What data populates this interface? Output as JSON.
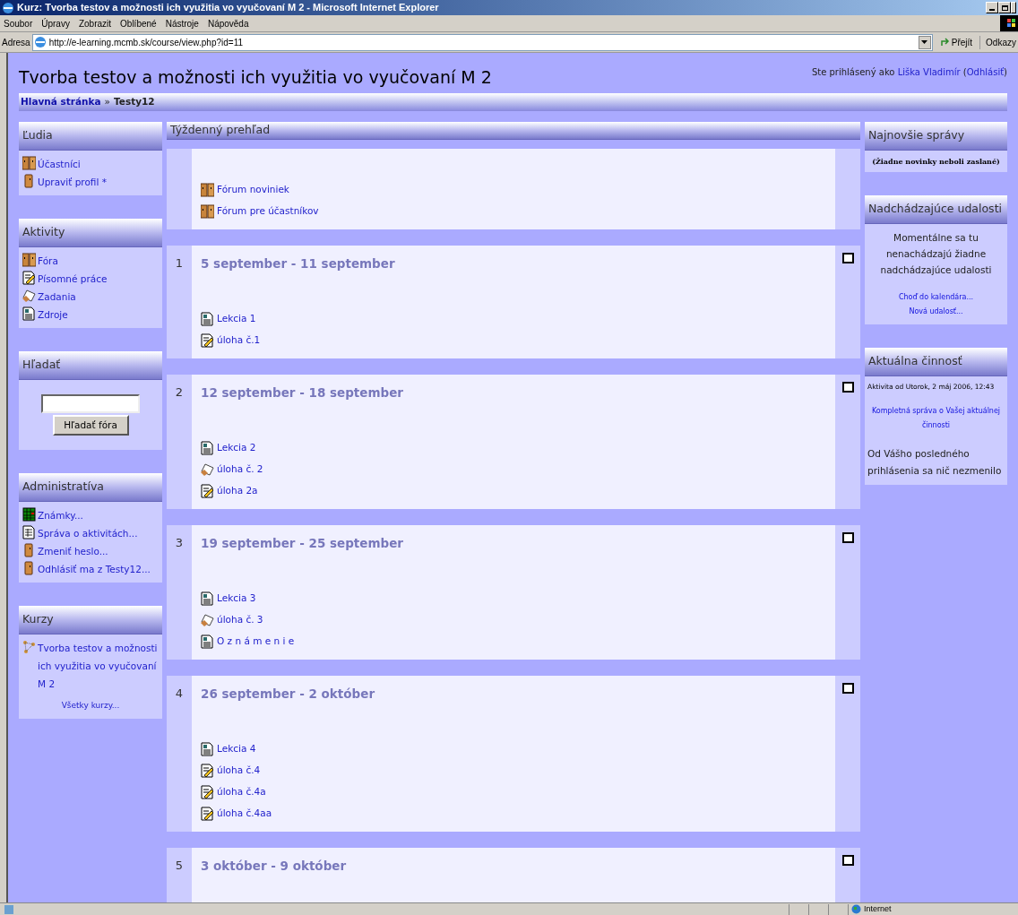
{
  "window": {
    "title": "Kurz: Tvorba testov a možnosti ich využitia vo vyučovaní M 2 - Microsoft Internet Explorer"
  },
  "menu": [
    "Soubor",
    "Úpravy",
    "Zobrazit",
    "Oblíbené",
    "Nástroje",
    "Nápověda"
  ],
  "address_bar": {
    "label": "Adresa",
    "url": "http://e-learning.mcmb.sk/course/view.php?id=11",
    "go": "Přejít",
    "links": "Odkazy"
  },
  "header": {
    "title": "Tvorba testov a možnosti ich využitia vo vyučovaní M 2",
    "login": {
      "prefix": "Ste prihlásený ako",
      "user": "Liška Vladimír",
      "open": "(",
      "logout": "Odhlásiť",
      "close": ")"
    }
  },
  "breadcrumb": {
    "items": [
      "Hlavná stránka",
      "Testy12"
    ],
    "separator": "»"
  },
  "left_blocks": [
    {
      "title": "Ľudia",
      "kind": "links",
      "items": [
        {
          "kind": "forum",
          "label": "Účastníci"
        },
        {
          "kind": "user",
          "label": "Upraviť profil *"
        }
      ]
    },
    {
      "title": "Aktivity",
      "kind": "links",
      "items": [
        {
          "kind": "forum",
          "label": "Fóra"
        },
        {
          "kind": "assignment",
          "label": "Písomné práce"
        },
        {
          "kind": "workshop",
          "label": "Zadania"
        },
        {
          "kind": "resource",
          "label": "Zdroje"
        }
      ]
    },
    {
      "title": "Hľadať",
      "kind": "search",
      "button": "Hľadať fóra"
    },
    {
      "title": "Administratíva",
      "kind": "links",
      "items": [
        {
          "kind": "grades",
          "label": "Známky..."
        },
        {
          "kind": "report",
          "label": "Správa o aktivitách..."
        },
        {
          "kind": "user",
          "label": "Zmeniť heslo..."
        },
        {
          "kind": "user",
          "label": "Odhlásiť ma z Testy12..."
        }
      ]
    },
    {
      "title": "Kurzy",
      "kind": "links",
      "items": [
        {
          "kind": "course",
          "label": "Tvorba testov a možnosti ich využitia vo vyučovaní M 2"
        }
      ],
      "footer": "Všetky kurzy..."
    }
  ],
  "main": {
    "title": "Týždenný prehľad",
    "sections": [
      {
        "items": [
          {
            "kind": "forum",
            "label": "Fórum noviniek"
          },
          {
            "kind": "forum",
            "label": "Fórum pre účastníkov"
          }
        ]
      },
      {
        "number": "1",
        "title": "5 september - 11 september",
        "items": [
          {
            "kind": "resource",
            "label": "Lekcia 1"
          },
          {
            "kind": "assignment",
            "label": "úloha č.1"
          }
        ]
      },
      {
        "number": "2",
        "title": "12 september - 18 september",
        "items": [
          {
            "kind": "resource",
            "label": "Lekcia 2"
          },
          {
            "kind": "workshop",
            "label": "úloha č. 2"
          },
          {
            "kind": "assignment",
            "label": "úloha 2a"
          }
        ]
      },
      {
        "number": "3",
        "title": "19 september - 25 september",
        "items": [
          {
            "kind": "resource",
            "label": "Lekcia 3"
          },
          {
            "kind": "workshop",
            "label": "úloha č. 3"
          },
          {
            "kind": "resource",
            "label": "O z n á m e n i e"
          }
        ]
      },
      {
        "number": "4",
        "title": "26 september - 2 október",
        "items": [
          {
            "kind": "resource",
            "label": "Lekcia 4"
          },
          {
            "kind": "assignment",
            "label": "úloha č.4"
          },
          {
            "kind": "assignment",
            "label": "úloha č.4a"
          },
          {
            "kind": "assignment",
            "label": "úloha č.4aa"
          }
        ]
      },
      {
        "number": "5",
        "title": "3 október - 9 október"
      }
    ]
  },
  "right_blocks": [
    {
      "title": "Najnovšie správy",
      "kind": "news",
      "text": "(Žiadne novinky neboli zaslané)"
    },
    {
      "title": "Nadchádzajúce udalosti",
      "kind": "events",
      "text": "Momentálne sa tu nenachádzajú žiadne nadchádzajúce udalosti",
      "links": [
        "Choď do kalendára...",
        "Nová udalosť..."
      ]
    },
    {
      "title": "Aktuálna činnosť",
      "kind": "activity",
      "since": "Aktivita od Utorok, 2 máj 2006, 12:43",
      "link": "Kompletná správa o Vašej aktuálnej činnosti",
      "text": "Od Vášho posledného prihlásenia sa nič nezmenilo"
    }
  ],
  "status_bar": {
    "zone": "Internet"
  }
}
